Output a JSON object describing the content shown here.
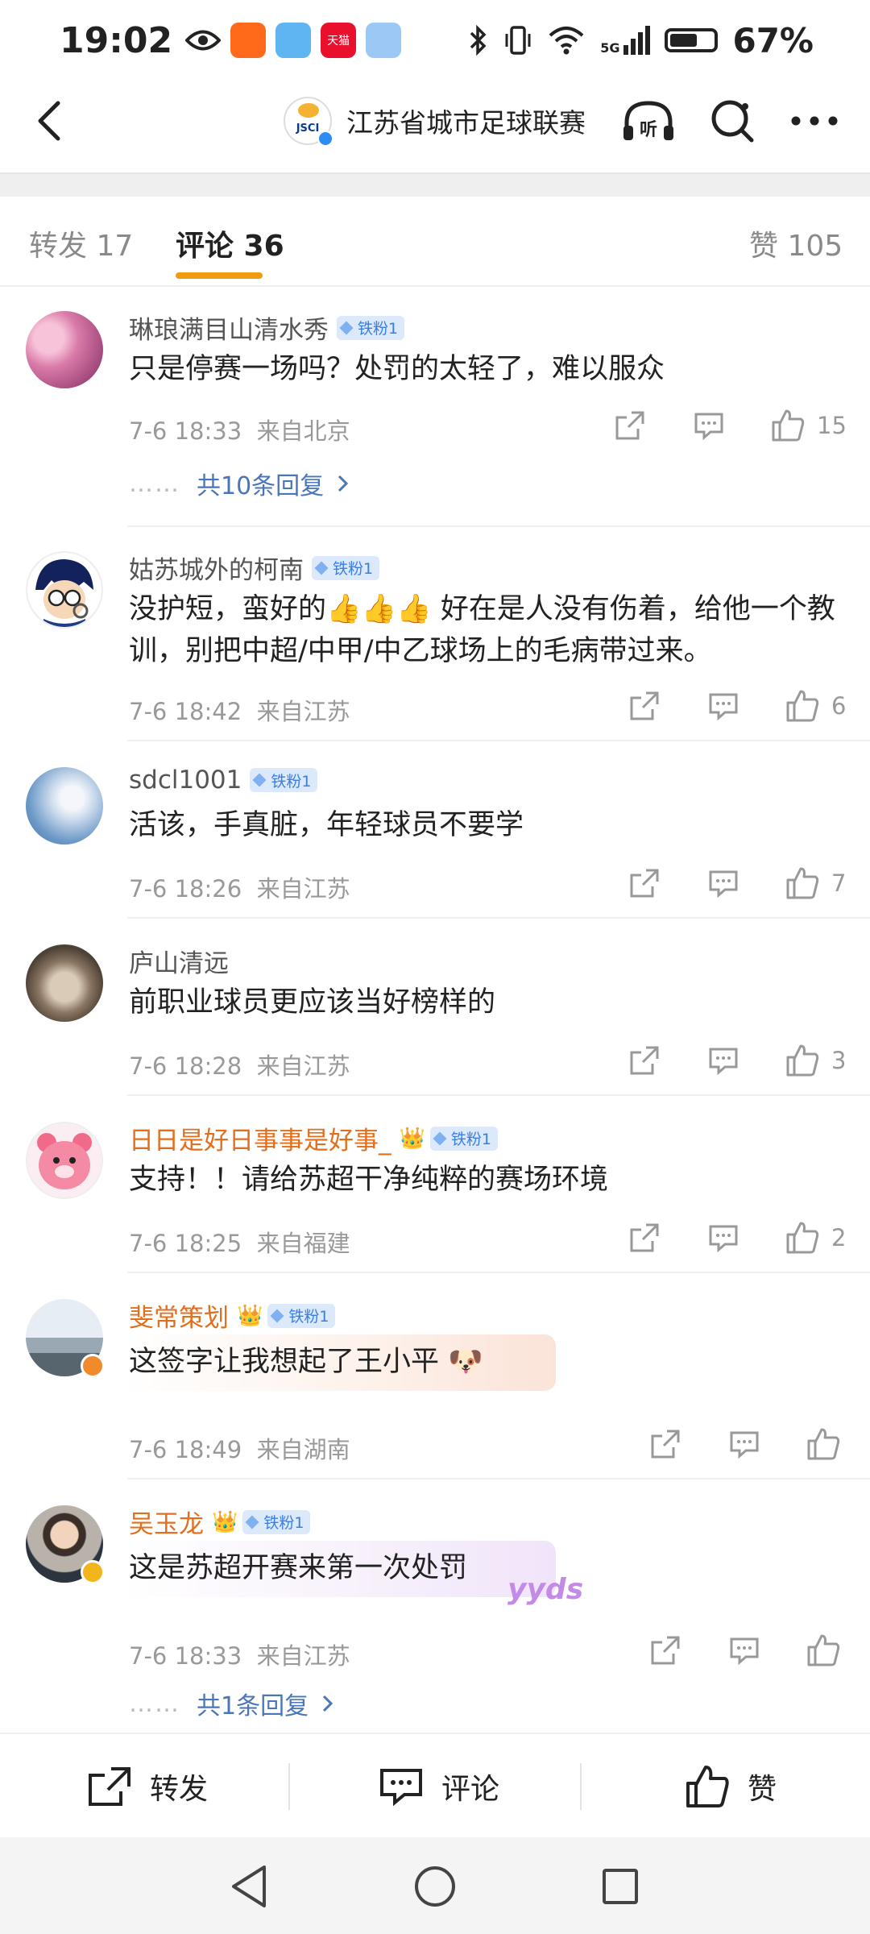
{
  "status_bar": {
    "time": "19:02",
    "battery_text": "67%",
    "battery_level": 0.67,
    "network": "5G",
    "app_chip_text": "天猫"
  },
  "header": {
    "account_name": "江苏省城市足球联赛",
    "avatar_text": "JSCI",
    "listen_label": "听"
  },
  "tabs": {
    "repost": "转发 17",
    "comments": "评论 36",
    "likes": "赞 105"
  },
  "comments": [
    {
      "name": "琳琅满目山清水秀",
      "fan_badge": "铁粉1",
      "text": "只是停赛一场吗？处罚的太轻了，难以服众",
      "time": "7-6 18:33",
      "location": "来自北京",
      "likes": "15",
      "replies": "共10条回复"
    },
    {
      "name": "姑苏城外的柯南",
      "fan_badge": "铁粉1",
      "text": "没护短，蛮好的👍👍👍 好在是人没有伤着，给他一个教训，别把中超/中甲/中乙球场上的毛病带过来。",
      "time": "7-6 18:42",
      "location": "来自江苏",
      "likes": "6"
    },
    {
      "name": "sdcl1001",
      "fan_badge": "铁粉1",
      "text": "活该，手真脏，年轻球员不要学",
      "time": "7-6 18:26",
      "location": "来自江苏",
      "likes": "7"
    },
    {
      "name": "庐山清远",
      "text": "前职业球员更应该当好榜样的",
      "time": "7-6 18:28",
      "location": "来自江苏",
      "likes": "3"
    },
    {
      "name": "日日是好日事事是好事_",
      "fan_badge": "铁粉1",
      "text": "支持！！请给苏超干净纯粹的赛场环境",
      "time": "7-6 18:25",
      "location": "来自福建",
      "likes": "2"
    },
    {
      "name": "斐常策划",
      "fan_badge": "铁粉1",
      "text": "这签字让我想起了王小平",
      "time": "7-6 18:49",
      "location": "来自湖南"
    },
    {
      "name": "吴玉龙",
      "fan_badge": "铁粉1",
      "text": "这是苏超开赛来第一次处罚",
      "sticker_text": "yyds",
      "time": "7-6 18:33",
      "location": "来自江苏",
      "replies": "共1条回复"
    }
  ],
  "bottom_bar": {
    "repost": "转发",
    "comment": "评论",
    "like": "赞"
  },
  "colors": {
    "accent_orange": "#f39c12",
    "vip_name": "#e36e1b",
    "link_blue": "#4a75b8",
    "fan_tag_bg": "#dbe9fb"
  }
}
